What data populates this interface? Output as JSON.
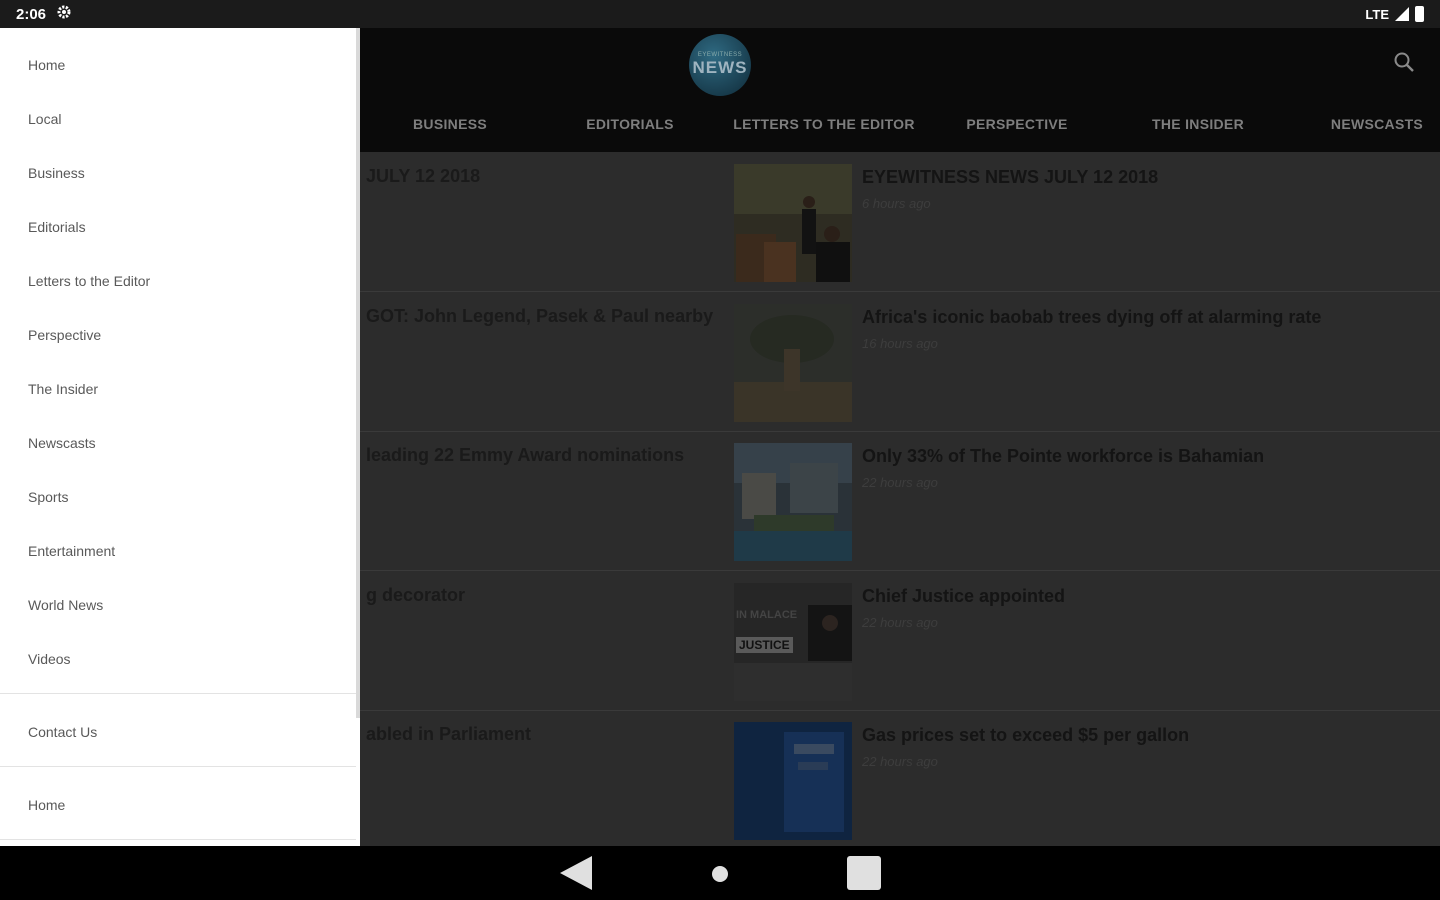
{
  "status_bar": {
    "time": "2:06",
    "network": "LTE"
  },
  "header": {
    "logo_small_text": "EYEWITNESS",
    "logo_text": "NEWS",
    "tabs": [
      {
        "label": "BUSINESS"
      },
      {
        "label": "EDITORIALS"
      },
      {
        "label": "LETTERS TO THE EDITOR"
      },
      {
        "label": "PERSPECTIVE"
      },
      {
        "label": "THE INSIDER"
      },
      {
        "label": "NEWSCASTS"
      }
    ]
  },
  "left_column": {
    "items": [
      {
        "title": "JULY 12 2018"
      },
      {
        "title": "GOT: John Legend, Pasek & Paul nearby"
      },
      {
        "title": "leading 22 Emmy Award nominations"
      },
      {
        "title": "g decorator"
      },
      {
        "title": "abled in Parliament"
      }
    ]
  },
  "news": {
    "items": [
      {
        "title": "EYEWITNESS NEWS JULY 12 2018",
        "time": "6 hours ago"
      },
      {
        "title": "Africa's iconic baobab trees dying off at alarming rate",
        "time": "16 hours ago"
      },
      {
        "title": "Only 33% of The Pointe workforce is Bahamian",
        "time": "22 hours ago"
      },
      {
        "title": "Chief Justice appointed",
        "time": "22 hours ago"
      },
      {
        "title": "Gas prices set to exceed $5 per gallon",
        "time": "22 hours ago"
      }
    ],
    "thumb_overlay": {
      "line1": "IN MALACE",
      "line2": "JUSTICE"
    }
  },
  "drawer": {
    "items": [
      {
        "label": "Home"
      },
      {
        "label": "Local"
      },
      {
        "label": "Business"
      },
      {
        "label": "Editorials"
      },
      {
        "label": "Letters to the Editor"
      },
      {
        "label": "Perspective"
      },
      {
        "label": "The Insider"
      },
      {
        "label": "Newscasts"
      },
      {
        "label": "Sports"
      },
      {
        "label": "Entertainment"
      },
      {
        "label": "World News"
      },
      {
        "label": "Videos"
      }
    ],
    "secondary": [
      {
        "label": "Contact Us"
      },
      {
        "label": "Home"
      }
    ]
  },
  "colors": {
    "drawer_bg": "#ffffff",
    "header_bg": "#0a0a0a",
    "scrim": "#2c2c2c"
  },
  "icons": {
    "search": "search-icon",
    "settings": "gear-icon",
    "back": "back-icon",
    "home": "home-icon",
    "recents": "recents-icon"
  }
}
